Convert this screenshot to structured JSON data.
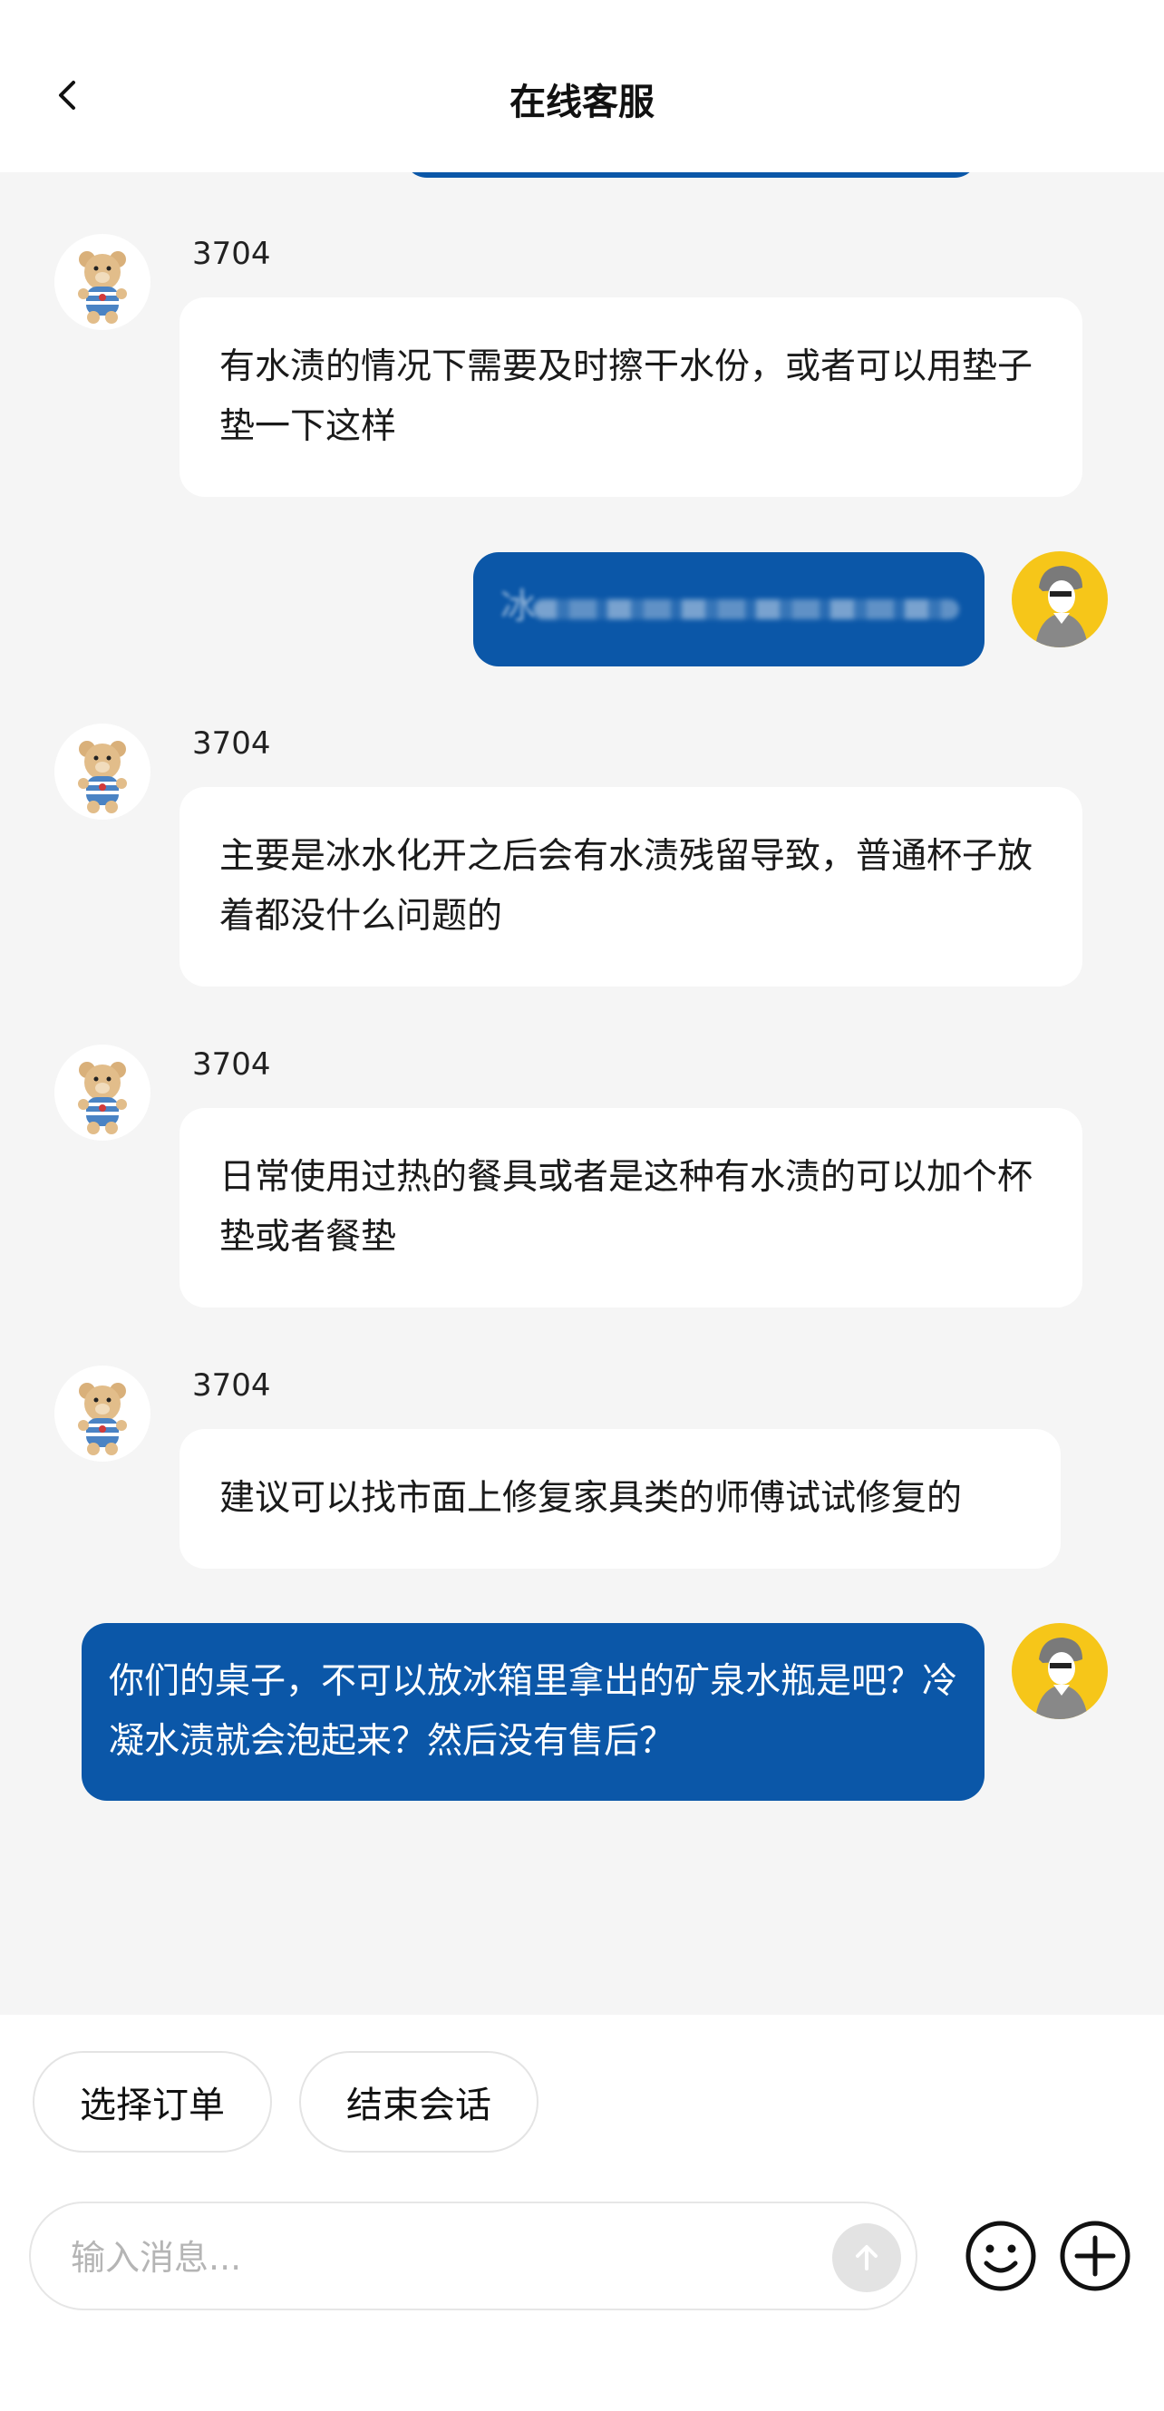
{
  "header": {
    "title": "在线客服"
  },
  "messages": [
    {
      "sender": "agent",
      "name": "3704",
      "text": "有水渍的情况下需要及时擦干水份，或者可以用垫子垫一下这样"
    },
    {
      "sender": "user",
      "text": "冰"
    },
    {
      "sender": "agent",
      "name": "3704",
      "text": "主要是冰水化开之后会有水渍残留导致，普通杯子放着都没什么问题的"
    },
    {
      "sender": "agent",
      "name": "3704",
      "text": "日常使用过热的餐具或者是这种有水渍的可以加个杯垫或者餐垫"
    },
    {
      "sender": "agent",
      "name": "3704",
      "text": "建议可以找市面上修复家具类的师傅试试修复的"
    },
    {
      "sender": "user",
      "text": "你们的桌子，不可以放冰箱里拿出的矿泉水瓶是吧？冷凝水渍就会泡起来？然后没有售后？"
    }
  ],
  "quick_actions": {
    "select_order": "选择订单",
    "end_session": "结束会话"
  },
  "composer": {
    "placeholder": "输入消息..."
  },
  "icons": {
    "back": "chevron-left-icon",
    "send": "arrow-up-icon",
    "emoji": "smiley-icon",
    "add": "plus-circle-icon",
    "agent_avatar": "teddy-bear-icon",
    "user_avatar": "person-silhouette-icon"
  },
  "colors": {
    "user_bubble": "#0b57a8",
    "user_avatar_bg": "#f6c619",
    "chat_bg": "#f5f5f5"
  }
}
